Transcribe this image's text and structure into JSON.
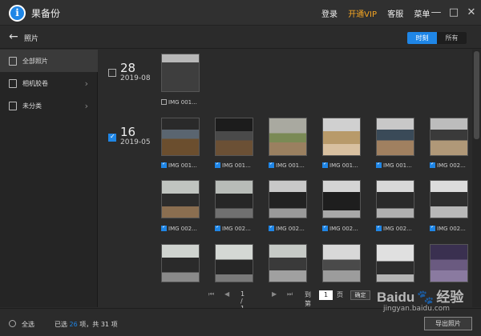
{
  "app": {
    "title": "果备份"
  },
  "top_menu": {
    "login": "登录",
    "vip": "开通VIP",
    "support": "客服",
    "menu": "菜单"
  },
  "window_controls": {
    "minimize": "—",
    "maximize": "□",
    "close": "✕"
  },
  "subbar": {
    "title": "照片",
    "toggle_time": "时刻",
    "toggle_all": "所有"
  },
  "sidebar": {
    "items": [
      {
        "label": "全部照片"
      },
      {
        "label": "相机胶卷"
      },
      {
        "label": "未分类"
      }
    ]
  },
  "groups": [
    {
      "day": "28",
      "month": "2019-08",
      "checked": false
    },
    {
      "day": "16",
      "month": "2019-05",
      "checked": true
    }
  ],
  "photos": {
    "group1": [
      "IMG 001..."
    ],
    "row1": [
      "IMG 001...",
      "IMG 001...",
      "IMG 001...",
      "IMG 001...",
      "IMG 001...",
      "IMG 002..."
    ],
    "row2": [
      "IMG 002...",
      "IMG 002...",
      "IMG 002...",
      "IMG 002...",
      "IMG 002...",
      "IMG 002..."
    ]
  },
  "pager": {
    "page_info": "1 / 1页",
    "goto_label": "到第",
    "goto_value": "1",
    "page_unit": "页",
    "confirm": "确定"
  },
  "footer": {
    "select_all": "全选",
    "selected_prefix": "已选",
    "selected_count": "26",
    "selected_mid": "项，共",
    "total_count": "31",
    "selected_suffix": "项",
    "export": "导出照片"
  },
  "watermark": {
    "brand": "Baidu",
    "brand_cn": "经验",
    "site": "jingyan.baidu.com"
  },
  "colors": {
    "accent": "#1f86e6",
    "vip": "#f5a623",
    "background": "#2b2b2b"
  }
}
